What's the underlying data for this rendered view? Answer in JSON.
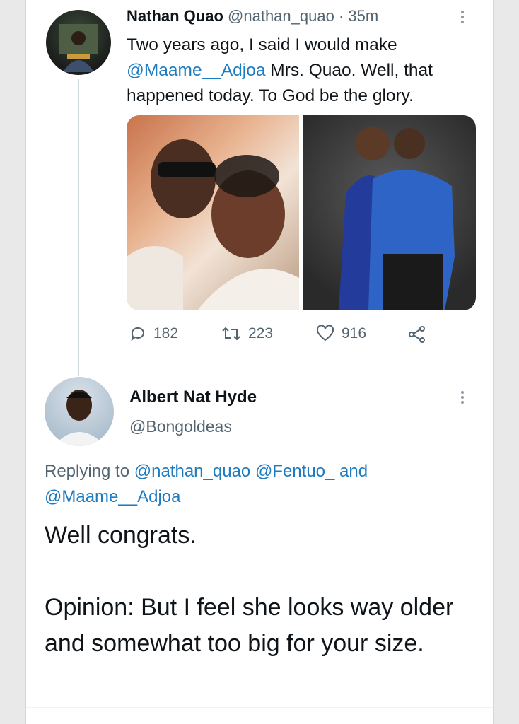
{
  "tweet1": {
    "name": "Nathan Quao",
    "handle": "@nathan_quao",
    "separator": "·",
    "time": "35m",
    "text_part1": "Two years ago, I said I would make",
    "mention": "@Maame__Adjoa",
    "text_part2": "Mrs. Quao. Well, that happened today. To God be the glory.",
    "stats": {
      "replies": "182",
      "retweets": "223",
      "likes": "916"
    }
  },
  "tweet2": {
    "name": "Albert Nat Hyde",
    "handle": "@Bongoldeas",
    "replying_prefix": "Replying to",
    "replying_to": [
      "@nathan_quao",
      "@Fentuo_",
      "@Maame__Adjoa"
    ],
    "replying_and": "and",
    "text_para1": "Well congrats.",
    "text_para2": "Opinion: But I feel she looks way older and somewhat too big for your size."
  },
  "colors": {
    "link": "#1d7bc0",
    "secondary_text": "#536471",
    "primary_text": "#0f1419"
  },
  "icons": [
    "reply-icon",
    "retweet-icon",
    "like-icon",
    "share-icon",
    "more-icon"
  ]
}
